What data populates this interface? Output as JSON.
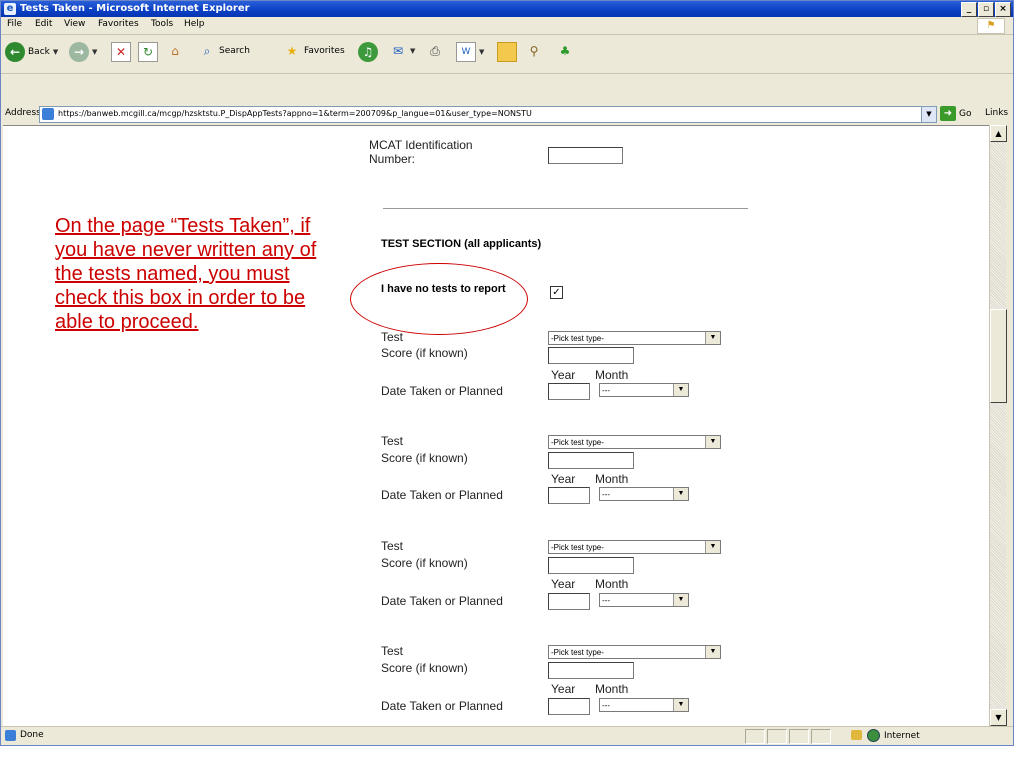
{
  "window": {
    "title": "Tests Taken - Microsoft Internet Explorer",
    "controls": [
      "_",
      "▫",
      "×"
    ]
  },
  "menu": [
    "File",
    "Edit",
    "View",
    "Favorites",
    "Tools",
    "Help"
  ],
  "toolbar": {
    "back": "Back",
    "search": "Search",
    "favorites": "Favorites"
  },
  "address": {
    "label": "Address",
    "url": "https://banweb.mcgill.ca/mcgp/hzsktstu.P_DispAppTests?appno=1&term=200709&p_langue=01&user_type=NONSTU",
    "go": "Go",
    "links": "Links"
  },
  "form": {
    "mcat_label": "MCAT Identification Number:",
    "section_title": "TEST SECTION (all applicants)",
    "no_tests_label": "I have no tests to report",
    "no_tests_checked": true,
    "test_blocks": [
      {
        "test_label": "Test",
        "score_label": "Score (if known)",
        "date_label": "Date Taken or Planned",
        "year_label": "Year",
        "month_label": "Month",
        "test_select": "-Pick test type-",
        "month_select": "---"
      },
      {
        "test_label": "Test",
        "score_label": "Score (if known)",
        "date_label": "Date Taken or Planned",
        "year_label": "Year",
        "month_label": "Month",
        "test_select": "-Pick test type-",
        "month_select": "---"
      },
      {
        "test_label": "Test",
        "score_label": "Score (if known)",
        "date_label": "Date Taken or Planned",
        "year_label": "Year",
        "month_label": "Month",
        "test_select": "-Pick test type-",
        "month_select": "---"
      },
      {
        "test_label": "Test",
        "score_label": "Score (if known)",
        "date_label": "Date Taken or Planned",
        "year_label": "Year",
        "month_label": "Month",
        "test_select": "-Pick test type-",
        "month_select": "---"
      }
    ]
  },
  "annotation": {
    "text": "On the page “Tests Taken”, if you have never written any of the tests named, you must check this box in order to be able to proceed.",
    "color": "#cc0000"
  },
  "status": {
    "text": "Done",
    "zone": "Internet"
  }
}
